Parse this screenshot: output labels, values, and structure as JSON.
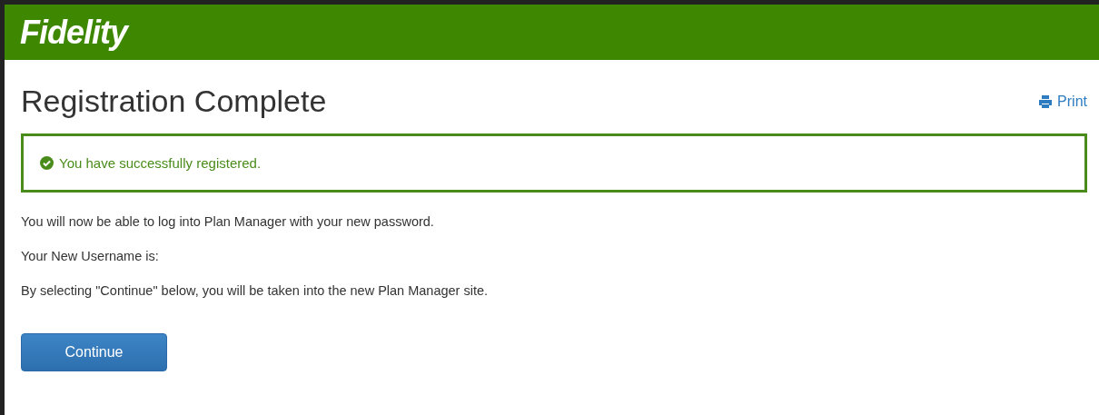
{
  "header": {
    "logo": "Fidelity"
  },
  "title": "Registration Complete",
  "print_link": "Print",
  "alert": {
    "kind": "success",
    "message": "You have successfully registered."
  },
  "paragraphs": [
    "You will now be able to log into Plan Manager with your new password.",
    "Your New Username is:",
    "By selecting \"Continue\" below, you will be taken into the new Plan Manager site."
  ],
  "buttons": [
    "Continue"
  ]
}
